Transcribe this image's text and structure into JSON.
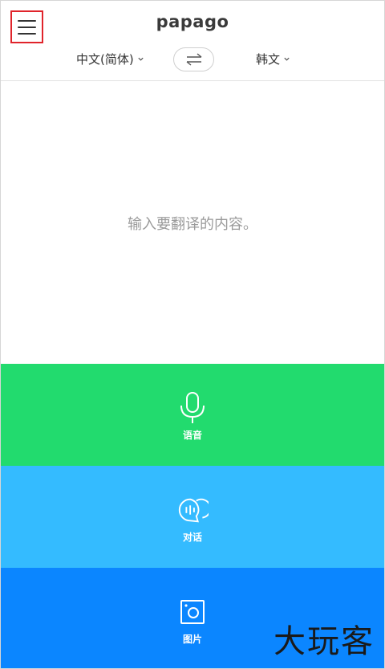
{
  "header": {
    "title": "papago",
    "menu_icon": "hamburger-menu-icon"
  },
  "languages": {
    "source": "中文(简体)",
    "target": "韩文",
    "swap_icon": "swap-arrows-icon",
    "dropdown_icon": "chevron-down-icon"
  },
  "input": {
    "placeholder": "输入要翻译的内容。",
    "value": ""
  },
  "actions": [
    {
      "label": "语音",
      "icon": "microphone-icon",
      "color": "#22db6e"
    },
    {
      "label": "对话",
      "icon": "conversation-icon",
      "color": "#34bbff"
    },
    {
      "label": "图片",
      "icon": "camera-icon",
      "color": "#0b86ff"
    }
  ],
  "watermark": "大玩客"
}
